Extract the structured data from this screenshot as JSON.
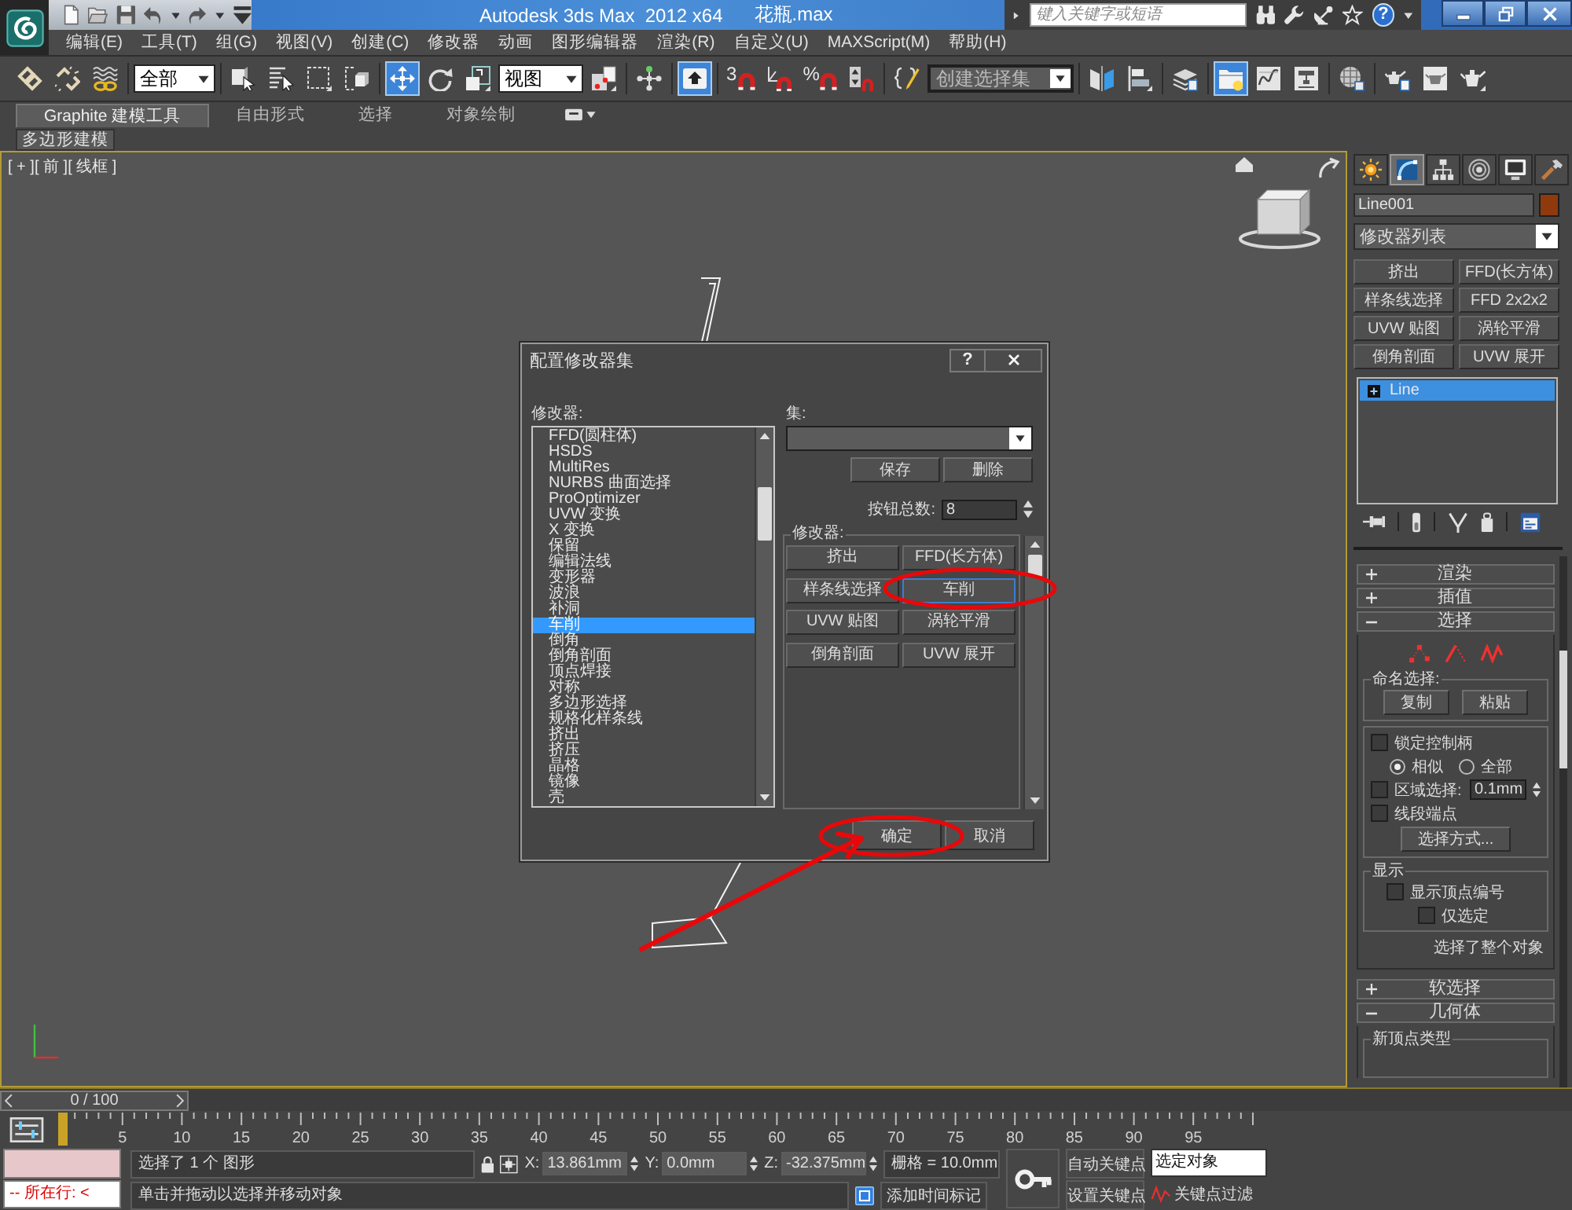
{
  "title_bar": {
    "title": "Autodesk 3ds Max  2012 x64",
    "file": "花瓶.max",
    "search": {
      "placeholder": "键入关键字或短语"
    },
    "help": "?"
  },
  "menu": [
    "编辑(E)",
    "工具(T)",
    "组(G)",
    "视图(V)",
    "创建(C)",
    "修改器",
    "动画",
    "图形编辑器",
    "渲染(R)",
    "自定义(U)",
    "MAXScript(M)",
    "帮助(H)"
  ],
  "main_toolbar": [
    {
      "kind": "tool",
      "selected": false
    },
    {
      "kind": "tool",
      "selected": false
    },
    {
      "kind": "tool",
      "selected": false
    },
    {
      "kind": "dropdown",
      "value": "全部"
    },
    {
      "kind": "tool",
      "selected": false
    },
    {
      "kind": "tool",
      "selected": false
    },
    {
      "kind": "tool",
      "selected": false
    },
    {
      "kind": "tool",
      "selected": false
    },
    {
      "kind": "tool",
      "selected": true
    },
    {
      "kind": "tool",
      "selected": false
    },
    {
      "kind": "tool",
      "selected": false
    },
    {
      "kind": "dropdown",
      "value": "视图"
    },
    {
      "kind": "tool",
      "selected": false
    },
    {
      "kind": "tool",
      "selected": false
    },
    {
      "kind": "tool",
      "selected": true
    },
    {
      "kind": "tool",
      "label": "3",
      "selected": false
    },
    {
      "kind": "tool",
      "selected": false
    },
    {
      "kind": "tool",
      "label": "%",
      "selected": false
    },
    {
      "kind": "tool",
      "selected": false
    },
    {
      "kind": "tool",
      "selected": false
    },
    {
      "kind": "dropdown",
      "placeholder": "创建选择集"
    },
    {
      "kind": "tool",
      "selected": false
    },
    {
      "kind": "tool",
      "selected": false
    },
    {
      "kind": "tool",
      "selected": false
    },
    {
      "kind": "tool",
      "selected": true
    },
    {
      "kind": "tool",
      "selected": false
    },
    {
      "kind": "tool",
      "selected": false
    },
    {
      "kind": "tool",
      "selected": false
    },
    {
      "kind": "tool",
      "selected": false
    },
    {
      "kind": "tool",
      "selected": false
    },
    {
      "kind": "tool",
      "selected": false
    }
  ],
  "ribbon": {
    "tabs": [
      {
        "label": "Graphite 建模工具",
        "selected": true
      },
      {
        "label": "自由形式",
        "selected": false
      },
      {
        "label": "选择",
        "selected": false
      },
      {
        "label": "对象绘制",
        "selected": false
      }
    ],
    "panels": [
      "多边形建模"
    ]
  },
  "viewport": {
    "label": "[ + ][ 前 ][ 线框 ]",
    "active": true
  },
  "dialog": {
    "title": "配置修改器集",
    "help": "?",
    "list_label": "修改器:",
    "modifiers": [
      {
        "label": "FFD(圆柱体)",
        "selected": false
      },
      {
        "label": "HSDS",
        "selected": false
      },
      {
        "label": "MultiRes",
        "selected": false
      },
      {
        "label": "NURBS 曲面选择",
        "selected": false
      },
      {
        "label": "ProOptimizer",
        "selected": false
      },
      {
        "label": "UVW 变换",
        "selected": false
      },
      {
        "label": "X 变换",
        "selected": false
      },
      {
        "label": "保留",
        "selected": false
      },
      {
        "label": "编辑法线",
        "selected": false
      },
      {
        "label": "变形器",
        "selected": false
      },
      {
        "label": "波浪",
        "selected": false
      },
      {
        "label": "补洞",
        "selected": false
      },
      {
        "label": "车削",
        "selected": true
      },
      {
        "label": "倒角",
        "selected": false
      },
      {
        "label": "倒角剖面",
        "selected": false
      },
      {
        "label": "顶点焊接",
        "selected": false
      },
      {
        "label": "对称",
        "selected": false
      },
      {
        "label": "多边形选择",
        "selected": false
      },
      {
        "label": "规格化样条线",
        "selected": false
      },
      {
        "label": "挤出",
        "selected": false
      },
      {
        "label": "挤压",
        "selected": false
      },
      {
        "label": "晶格",
        "selected": false
      },
      {
        "label": "镜像",
        "selected": false
      },
      {
        "label": "壳",
        "selected": false
      }
    ],
    "set_label": "集:",
    "set_buttons": [
      "保存",
      "删除"
    ],
    "count_label": "按钮总数:",
    "count": "8",
    "slots_label": "修改器:",
    "slots": [
      {
        "label": "挤出",
        "selected": false
      },
      {
        "label": "FFD(长方体)",
        "selected": false
      },
      {
        "label": "样条线选择",
        "selected": false
      },
      {
        "label": "车削",
        "selected": true
      },
      {
        "label": "UVW 贴图",
        "selected": false
      },
      {
        "label": "涡轮平滑",
        "selected": false
      },
      {
        "label": "倒角剖面",
        "selected": false
      },
      {
        "label": "UVW 展开",
        "selected": false
      }
    ],
    "buttons": [
      "确定",
      "取消"
    ]
  },
  "command_panel": {
    "tabs": [
      {
        "selected": false
      },
      {
        "selected": true
      },
      {
        "selected": false
      },
      {
        "selected": false
      },
      {
        "selected": false
      },
      {
        "selected": false
      }
    ],
    "object_name": "Line001",
    "modifier_list": "修改器列表",
    "modifier_buttons": [
      "挤出",
      "FFD(长方体)",
      "样条线选择",
      "FFD 2x2x2",
      "UVW 贴图",
      "涡轮平滑",
      "倒角剖面",
      "UVW 展开"
    ],
    "stack": [
      {
        "label": "Line",
        "selected": true,
        "expanded": false
      }
    ],
    "rollouts": [
      {
        "title": "渲染",
        "expanded": false
      },
      {
        "title": "插值",
        "expanded": false
      },
      {
        "kind": "selection",
        "title": "选择",
        "expanded": true,
        "named_selection": {
          "label": "命名选择:",
          "buttons": [
            "复制",
            "粘贴"
          ]
        },
        "options": [
          {
            "kind": "checkbox",
            "label": "锁定控制柄",
            "checked": false
          },
          {
            "kind": "radios",
            "options": [
              {
                "label": "相似",
                "selected": true
              },
              {
                "label": "全部",
                "selected": false
              }
            ]
          },
          {
            "kind": "checkbox_spinner",
            "label": "区域选择:",
            "checked": false,
            "value": "0.1mm"
          },
          {
            "kind": "checkbox",
            "label": "线段端点",
            "checked": false
          },
          {
            "kind": "button",
            "label": "选择方式..."
          }
        ],
        "display": {
          "label": "显示",
          "options": [
            {
              "label": "显示顶点编号",
              "checked": false,
              "children": [
                {
                  "label": "仅选定",
                  "checked": false
                }
              ]
            }
          ]
        },
        "status": "选择了整个对象"
      },
      {
        "title": "软选择",
        "expanded": false
      },
      {
        "kind": "geometry",
        "title": "几何体",
        "expanded": true,
        "group": "新顶点类型"
      }
    ]
  },
  "timeline": {
    "frame": "0 / 100",
    "level": 0,
    "ticks": [
      "5",
      "10",
      "15",
      "20",
      "25",
      "30",
      "35",
      "40",
      "45",
      "50",
      "55",
      "60",
      "65",
      "70",
      "75",
      "80",
      "85",
      "90",
      "95"
    ]
  },
  "status_bar": {
    "listener": "-- 所在行: <",
    "prompt": "选择了 1 个 图形",
    "hint": "单击并拖动以选择并移动对象",
    "coords": [
      {
        "axis": "X:",
        "value": "13.861mm"
      },
      {
        "axis": "Y:",
        "value": "0.0mm"
      },
      {
        "axis": "Z:",
        "value": "-32.375mm"
      }
    ],
    "grid": "栅格 = 10.0mm",
    "time_tag": "添加时间标记",
    "auto_key": "自动关键点",
    "set_key": "设置关键点",
    "key_mode": "选定对象",
    "key_filters": "关键点过滤"
  }
}
